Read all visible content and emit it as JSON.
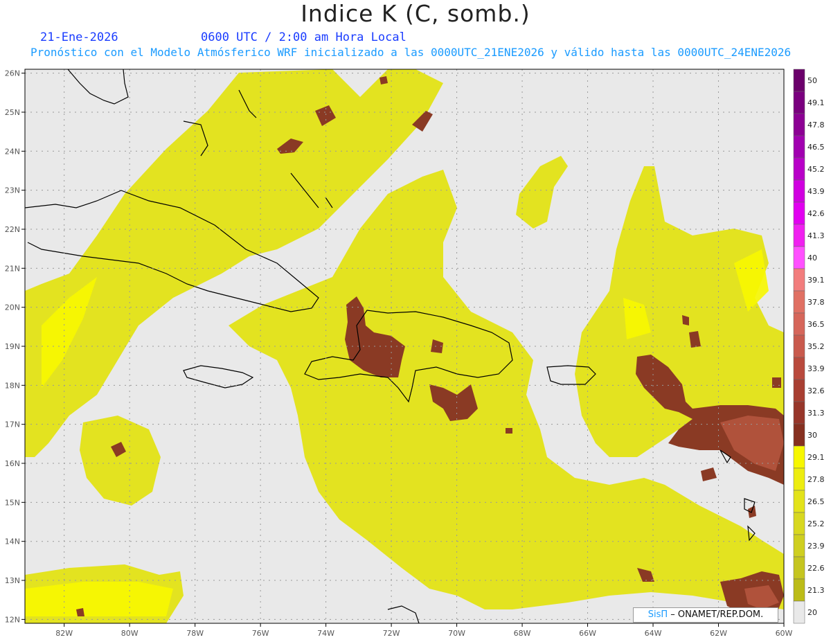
{
  "header": {
    "title": "Indice K (C, somb.)",
    "date": "21-Ene-2026",
    "time": "0600 UTC / 2:00 am Hora Local",
    "subtitle": "Pronóstico con el Modelo Atmósferico WRF inicializado a las 0000UTC_21ENE2026 y válido hasta las  0000UTC_24ENE2026"
  },
  "map": {
    "lon_range": [
      -83.2,
      -60
    ],
    "lat_range": [
      11.9,
      26.1
    ],
    "lon_ticks": [
      "82W",
      "80W",
      "78W",
      "76W",
      "74W",
      "72W",
      "70W",
      "68W",
      "66W",
      "64W",
      "62W",
      "60W"
    ],
    "lat_ticks": [
      "26N",
      "25N",
      "24N",
      "23N",
      "22N",
      "21N",
      "20N",
      "19N",
      "18N",
      "17N",
      "16N",
      "15N",
      "14N",
      "13N",
      "12N"
    ],
    "background_color": "#e9e9e9",
    "grid": "dotted"
  },
  "colorbar": {
    "levels": [
      "50",
      "49.1",
      "47.8",
      "46.5",
      "45.2",
      "43.9",
      "42.6",
      "41.3",
      "40",
      "39.1",
      "37.8",
      "36.5",
      "35.2",
      "33.9",
      "32.6",
      "31.3",
      "30",
      "29.1",
      "27.8",
      "26.5",
      "25.2",
      "23.9",
      "22.6",
      "21.3",
      "20"
    ],
    "colors": [
      "#6b006b",
      "#7a007f",
      "#8c0094",
      "#a100b0",
      "#b800c8",
      "#d000e0",
      "#e100f0",
      "#f020f0",
      "#ff50ff",
      "#f27d7d",
      "#e07063",
      "#d6665a",
      "#c95a4d",
      "#b94a3d",
      "#a83f32",
      "#97362a",
      "#863020",
      "#f7f700",
      "#eded10",
      "#e3e31a",
      "#d8d820",
      "#cfcf20",
      "#c5c520",
      "#bcbc18",
      "#e9e9e9"
    ]
  },
  "credit": {
    "sis": "SisΠ",
    "org": " – ONAMET/REP.DOM."
  }
}
